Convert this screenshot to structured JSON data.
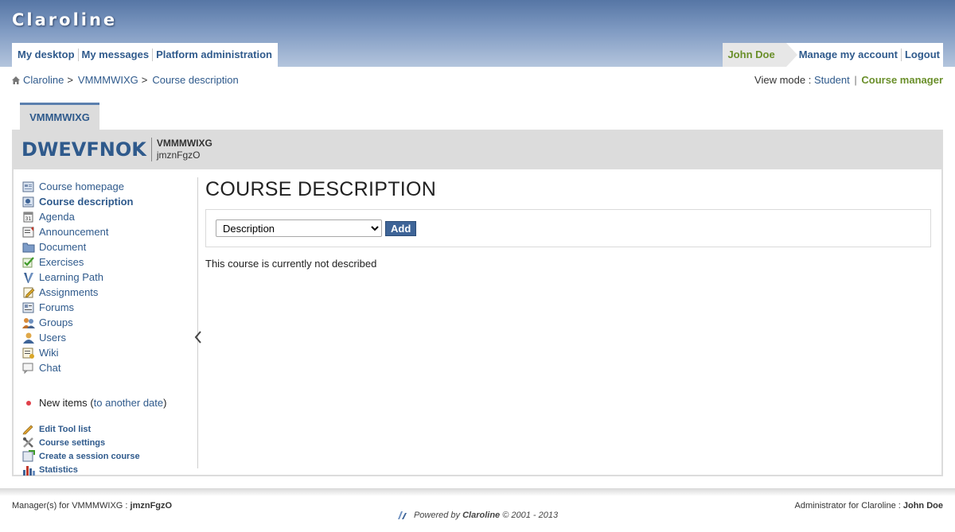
{
  "site_name": "Claroline",
  "user_tabs": [
    "My desktop",
    "My messages",
    "Platform administration"
  ],
  "account": {
    "username": "John Doe",
    "manage": "Manage my account",
    "logout": "Logout"
  },
  "breadcrumb": {
    "home": "Claroline",
    "course": "VMMMWIXG",
    "current": "Course description",
    "separator": ">"
  },
  "view_mode": {
    "label": "View mode :",
    "student": "Student",
    "separator": "|",
    "manager": "Course manager"
  },
  "course": {
    "tab": "VMMMWIXG",
    "title": "DWEVFNOK",
    "code": "VMMMWIXG",
    "manager": "jmznFgzO"
  },
  "tools": [
    {
      "label": "Course homepage",
      "icon": "course-homepage-icon",
      "active": false
    },
    {
      "label": "Course description",
      "icon": "course-description-icon",
      "active": true
    },
    {
      "label": "Agenda",
      "icon": "agenda-icon",
      "active": false
    },
    {
      "label": "Announcement",
      "icon": "announcement-icon",
      "active": false
    },
    {
      "label": "Document",
      "icon": "folder-icon",
      "active": false
    },
    {
      "label": "Exercises",
      "icon": "checkmark-icon",
      "active": false
    },
    {
      "label": "Learning Path",
      "icon": "learning-path-icon",
      "active": false
    },
    {
      "label": "Assignments",
      "icon": "assignments-icon",
      "active": false
    },
    {
      "label": "Forums",
      "icon": "forums-icon",
      "active": false
    },
    {
      "label": "Groups",
      "icon": "groups-icon",
      "active": false
    },
    {
      "label": "Users",
      "icon": "user-icon",
      "active": false
    },
    {
      "label": "Wiki",
      "icon": "wiki-icon",
      "active": false
    },
    {
      "label": "Chat",
      "icon": "chat-icon",
      "active": false
    }
  ],
  "new_items": {
    "label": "New items",
    "open_paren": "(",
    "link": "to another date",
    "close_paren": ")"
  },
  "admin_tools": [
    {
      "label": "Edit Tool list",
      "icon": "pencil-icon"
    },
    {
      "label": "Course settings",
      "icon": "tools-icon"
    },
    {
      "label": "Create a session course",
      "icon": "session-course-icon"
    },
    {
      "label": "Statistics",
      "icon": "statistics-icon"
    }
  ],
  "content": {
    "title": "COURSE DESCRIPTION",
    "select_value": "Description",
    "add_label": "Add",
    "empty_message": "This course is currently not described"
  },
  "footer": {
    "manager_label": "Manager(s) for VMMMWIXG :",
    "manager_name": "jmznFgzO",
    "admin_label": "Administrator for Claroline :",
    "admin_name": "John Doe",
    "powered_prefix": "Powered by",
    "powered_brand": "Claroline",
    "powered_suffix": "© 2001 - 2013"
  },
  "colors": {
    "banner": "#5676a5",
    "link": "#2f5a8c",
    "active_green": "#6a8f2a",
    "button": "#3e6497"
  }
}
